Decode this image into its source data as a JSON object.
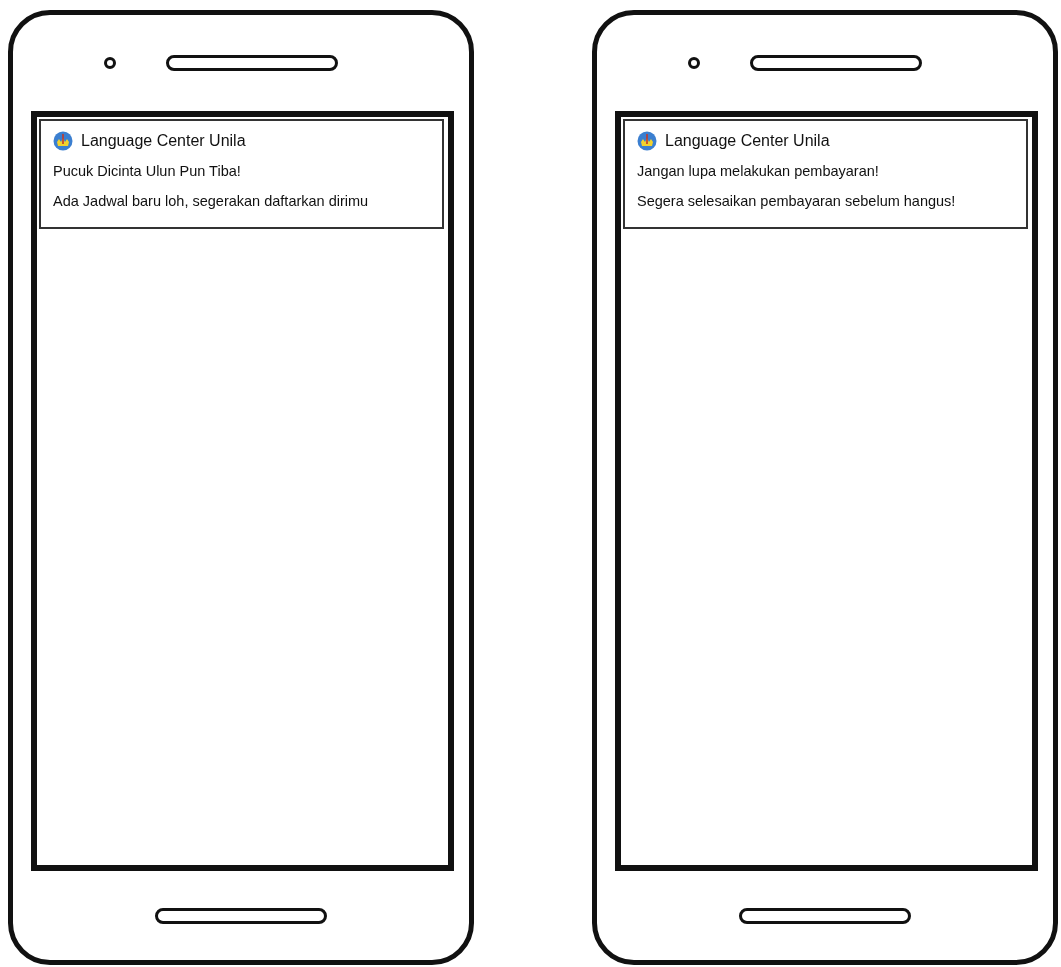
{
  "phones": [
    {
      "notification": {
        "app_name": "Language Center Unila",
        "title": "Pucuk Dicinta Ulun Pun Tiba!",
        "message": "Ada Jadwal baru loh, segerakan daftarkan dirimu"
      }
    },
    {
      "notification": {
        "app_name": "Language Center Unila",
        "title": "Jangan lupa melakukan pembayaran!",
        "message": "Segera selesaikan pembayaran sebelum hangus!"
      }
    }
  ]
}
